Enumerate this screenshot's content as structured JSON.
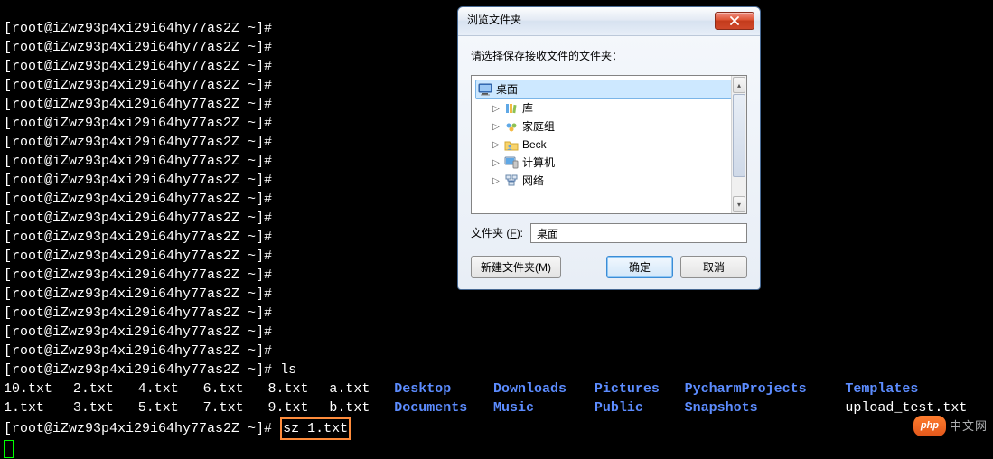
{
  "prompt_prefix": "[root@iZwz93p4xi29i64hy77as2Z ~]#",
  "ls_cmd": "ls",
  "sz_cmd": "sz 1.txt",
  "row1": {
    "c0": "10.txt",
    "c1": "2.txt",
    "c2": "4.txt",
    "c3": "6.txt",
    "c4": "8.txt",
    "c5": "a.txt",
    "c6": "Desktop",
    "c7": "Downloads",
    "c8": "Pictures",
    "c9": "PycharmProjects",
    "c10": "Templates"
  },
  "row2": {
    "c0": "1.txt",
    "c1": "3.txt",
    "c2": "5.txt",
    "c3": "7.txt",
    "c4": "9.txt",
    "c5": "b.txt",
    "c6": "Documents",
    "c7": "Music",
    "c8": "Public",
    "c9": "Snapshots",
    "c10": "upload_test.txt"
  },
  "dialog": {
    "title": "浏览文件夹",
    "instruction": "请选择保存接收文件的文件夹：",
    "tree": {
      "desktop": "桌面",
      "libraries": "库",
      "homegroup": "家庭组",
      "user": "Beck",
      "computer": "计算机",
      "network": "网络"
    },
    "folder_label_pre": "文件夹 (",
    "folder_label_key": "F",
    "folder_label_post": "):",
    "folder_value": "桌面",
    "new_folder_label": "新建文件夹(M)",
    "ok_label": "确定",
    "cancel_label": "取消"
  },
  "watermark": {
    "pill": "php",
    "cn": "中文网"
  }
}
